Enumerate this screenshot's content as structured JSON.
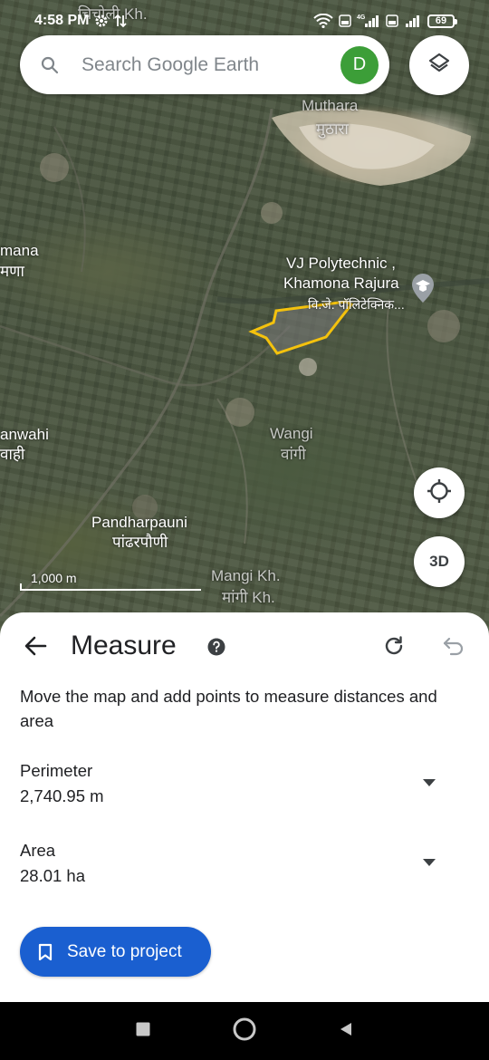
{
  "status_bar": {
    "time": "4:58 PM",
    "battery": "69",
    "network_label": "4G"
  },
  "search": {
    "placeholder": "Search Google Earth",
    "avatar_initial": "D"
  },
  "map": {
    "labels": {
      "top_partial_hindi": "चिचोली Kh.",
      "muthara": "Muthara",
      "muthara_hindi": "मुठारा",
      "khamona_partial": "mana",
      "khamona_partial_hindi": "मणा",
      "polytechnic_line1": "VJ Polytechnic ,",
      "polytechnic_line2": "Khamona Rajura",
      "polytechnic_hindi": "वि.जे. पॉलिटेक्निक...",
      "wanwahi_partial": "anwahi",
      "wanwahi_partial_hindi": "वाही",
      "wangi": "Wangi",
      "wangi_hindi": "वांगी",
      "pandharpauni": "Pandharpauni",
      "pandharpauni_hindi": "पांढरपौणी",
      "mangi": "Mangi Kh.",
      "mangi_hindi": "मांगी Kh."
    },
    "scale_label": "1,000 m",
    "three_d_label": "3D",
    "polygon_color": "#f4c20d"
  },
  "sheet": {
    "title": "Measure",
    "instructions": "Move the map and add points to measure distances and area",
    "perimeter_label": "Perimeter",
    "perimeter_value": "2,740.95 m",
    "area_label": "Area",
    "area_value": "28.01 ha",
    "save_label": "Save to project"
  },
  "colors": {
    "accent": "#1a5fd0",
    "avatar": "#3c9e38"
  }
}
